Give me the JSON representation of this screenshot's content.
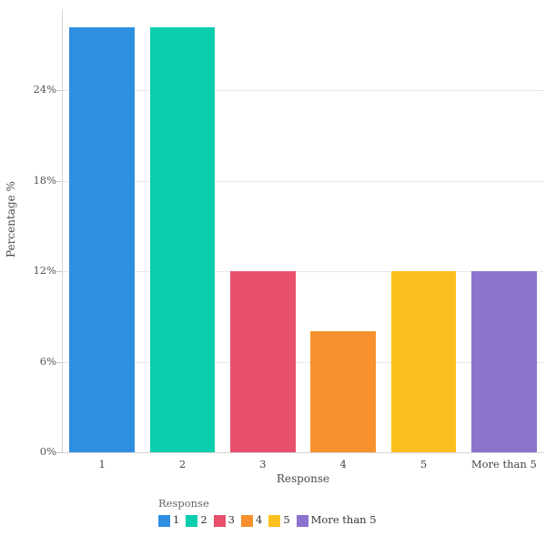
{
  "chart_data": {
    "type": "bar",
    "title": "",
    "subtitle": "",
    "xlabel": "Response",
    "ylabel": "Percentage %",
    "categories": [
      "1",
      "2",
      "3",
      "4",
      "5",
      "More than 5"
    ],
    "values": [
      28.2,
      28.2,
      12,
      8,
      12,
      12
    ],
    "ylim": [
      0,
      29.4
    ],
    "xlim_categories": 6,
    "ytick_values": [
      0,
      6,
      12,
      18,
      24
    ],
    "ytick_labels": [
      "0%",
      "6%",
      "12%",
      "18%",
      "24%"
    ],
    "xtick_labels": [
      "1",
      "2",
      "3",
      "4",
      "5",
      "More than 5"
    ],
    "grid": {
      "horizontal": true,
      "vertical": false,
      "color": "#e8e8e8"
    },
    "legend": {
      "position": "bottom",
      "title": "Response",
      "entries": [
        {
          "label": "1",
          "color": "#2e8fe0"
        },
        {
          "label": "2",
          "color": "#0acEae"
        },
        {
          "label": "3",
          "color": "#e9506e"
        },
        {
          "label": "4",
          "color": "#f7912e"
        },
        {
          "label": "5",
          "color": "#fcc01e"
        },
        {
          "label": "More than 5",
          "color": "#8b73ce"
        }
      ]
    },
    "series": [
      {
        "name": "Response",
        "values": [
          28.2,
          28.2,
          12,
          8,
          12,
          12
        ],
        "colors": [
          "#2e8fe0",
          "#0acEae",
          "#e9506e",
          "#f7912e",
          "#fcc01e",
          "#8b73ce"
        ]
      }
    ],
    "bars": [
      {
        "category": "1",
        "value": 28.2,
        "color": "#2e8fe0"
      },
      {
        "category": "2",
        "value": 28.2,
        "color": "#0acEae"
      },
      {
        "category": "3",
        "value": 12,
        "color": "#e9506e"
      },
      {
        "category": "4",
        "value": 8,
        "color": "#f7912e"
      },
      {
        "category": "5",
        "value": 12,
        "color": "#fcc01e"
      },
      {
        "category": "More than 5",
        "value": 12,
        "color": "#8b73ce"
      }
    ],
    "background_color": "#ffffff",
    "axis_color": "#d4d4d4"
  }
}
